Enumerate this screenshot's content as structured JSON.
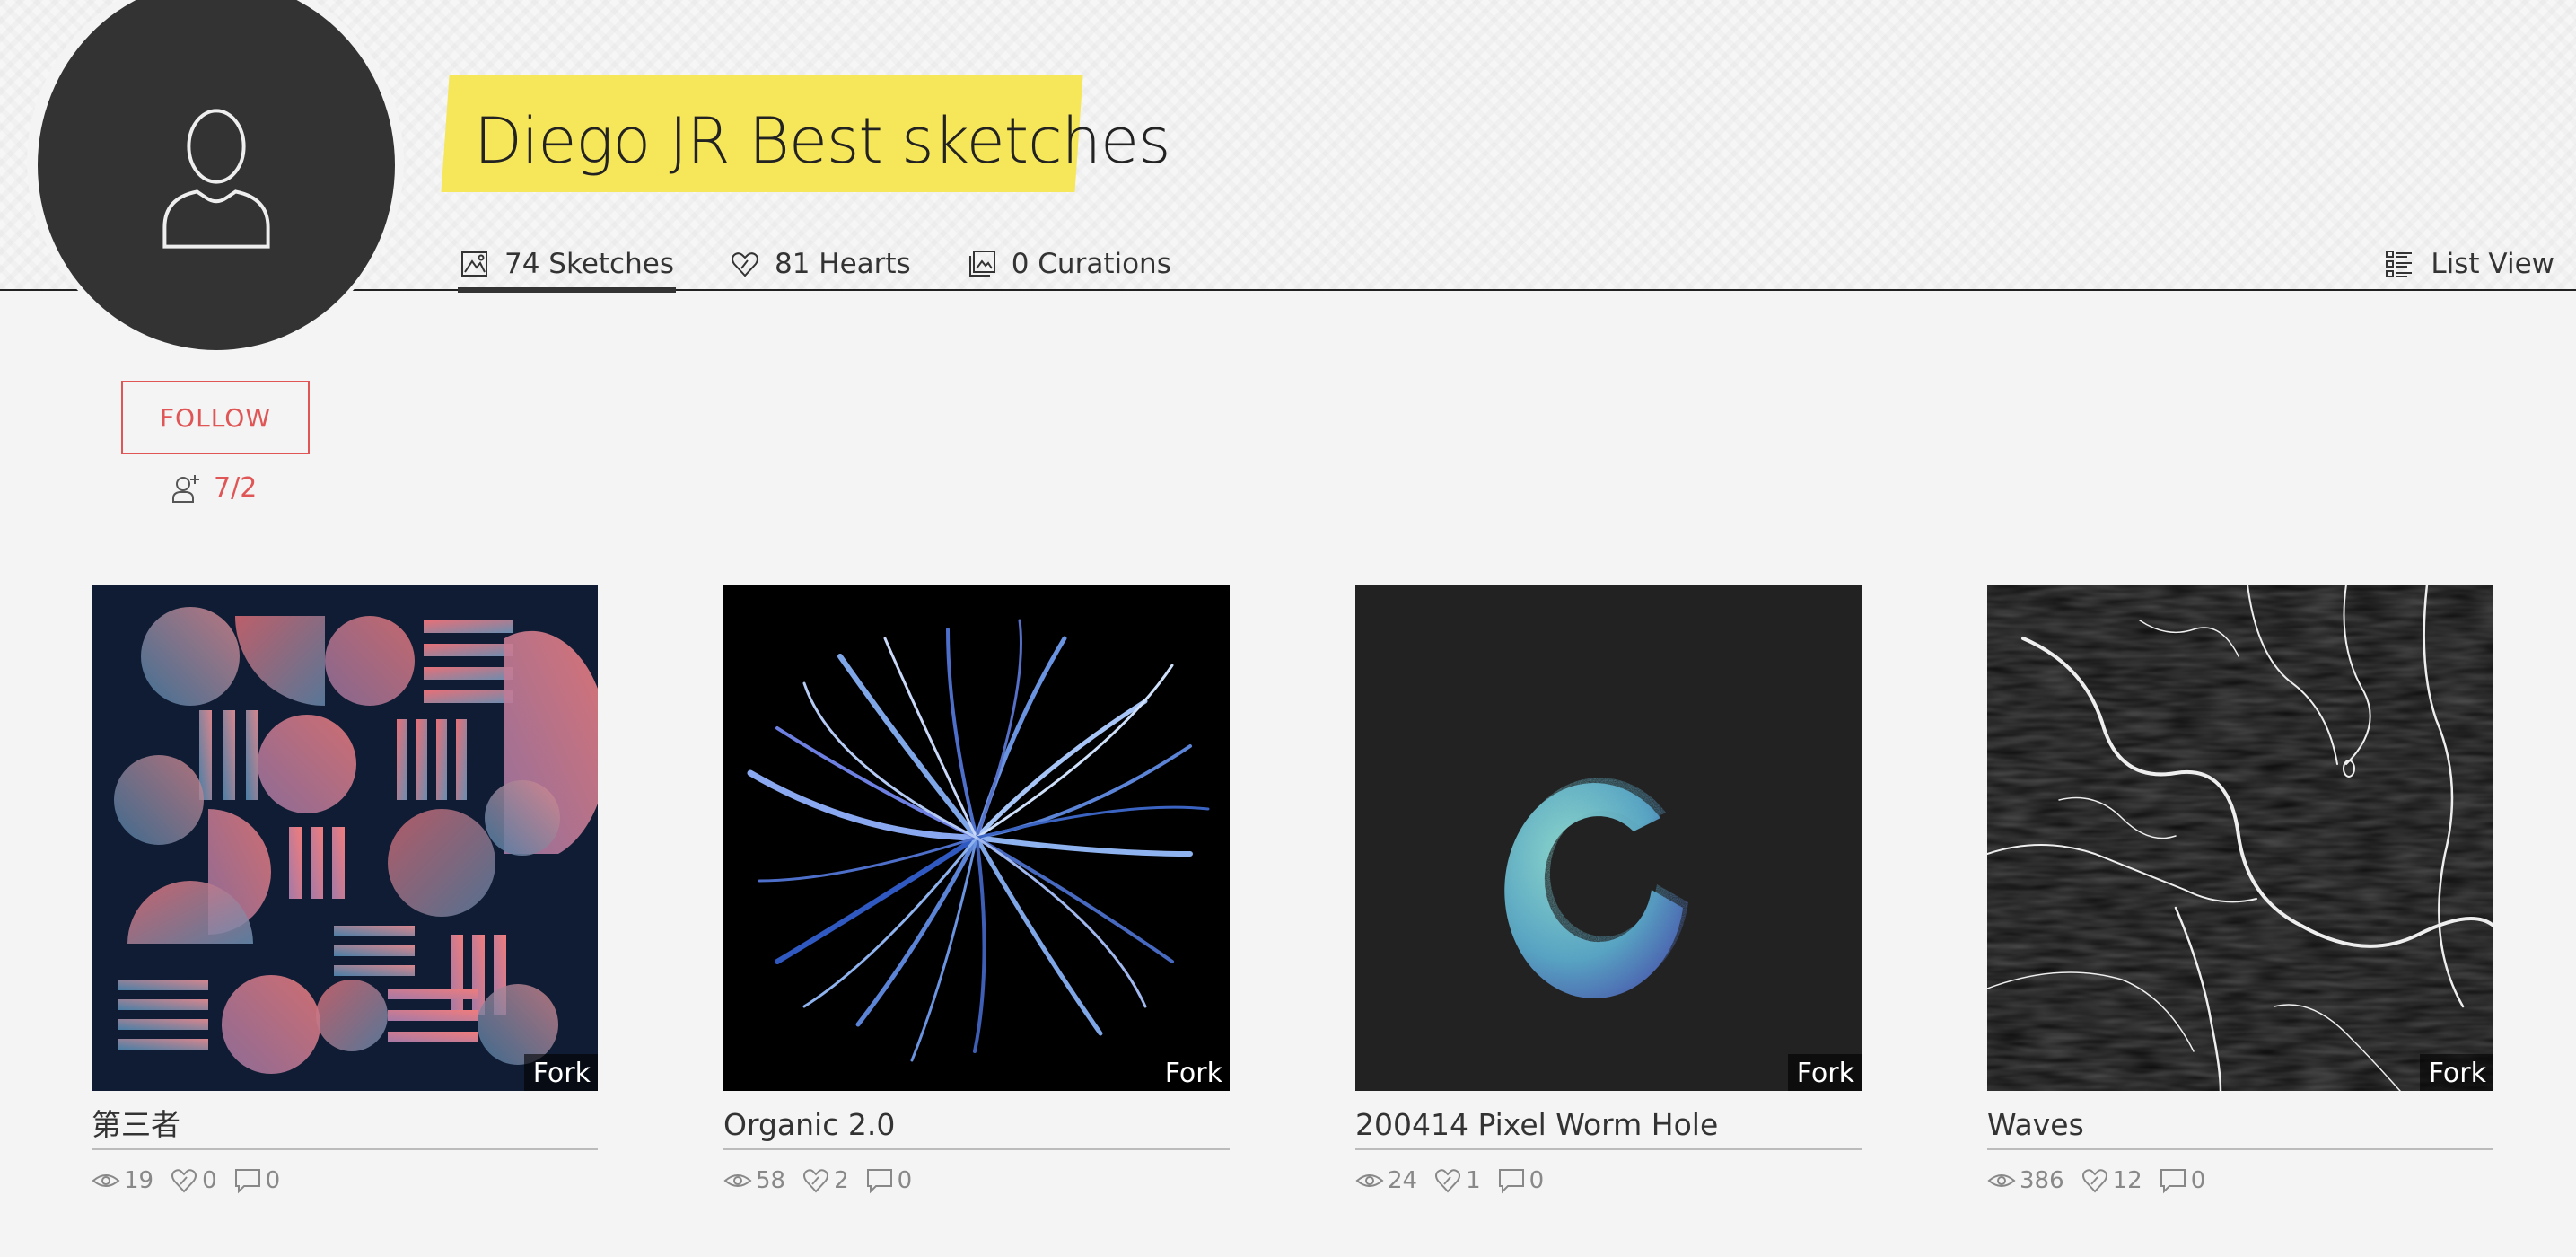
{
  "profile": {
    "title": "Diego JR Best sketches",
    "follow_label": "FOLLOW",
    "follow_count": "7/2"
  },
  "tabs": [
    {
      "label": "74 Sketches",
      "icon": "sketches-icon",
      "active": true
    },
    {
      "label": "81 Hearts",
      "icon": "heart-icon",
      "active": false
    },
    {
      "label": "0 Curations",
      "icon": "curations-icon",
      "active": false
    }
  ],
  "view_toggle": {
    "label": "List View",
    "icon": "list-view-icon"
  },
  "fork_label": "Fork",
  "sketches": [
    {
      "title": "第三者",
      "views": "19",
      "hearts": "0",
      "comments": "0"
    },
    {
      "title": "Organic 2.0",
      "views": "58",
      "hearts": "2",
      "comments": "0"
    },
    {
      "title": "200414 Pixel Worm Hole",
      "views": "24",
      "hearts": "1",
      "comments": "0"
    },
    {
      "title": "Waves",
      "views": "386",
      "hearts": "12",
      "comments": "0"
    }
  ],
  "colors": {
    "accent": "#e05555",
    "title_highlight": "#f6e65a",
    "avatar_bg": "#333333"
  }
}
